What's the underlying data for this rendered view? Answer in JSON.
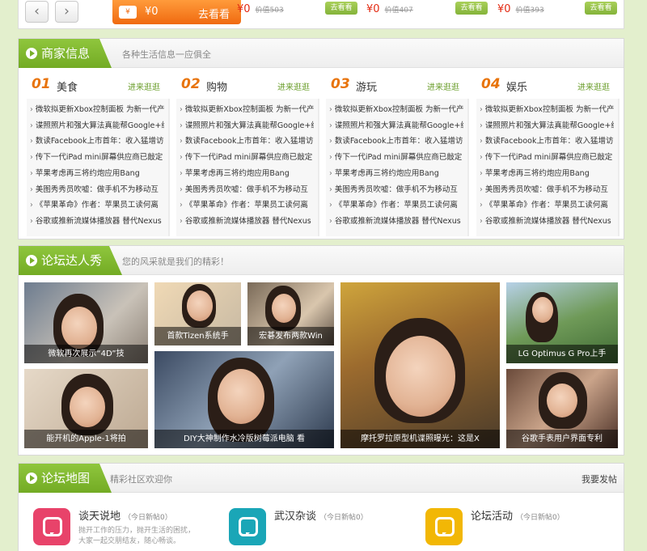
{
  "topstrip": {
    "prev_icon": "‹",
    "next_icon": "›",
    "pill_tag": "¥",
    "pill_price": "¥0",
    "pill_look": "去看看",
    "deals": [
      {
        "price": "¥0",
        "old": "价值503",
        "button": "去看看"
      },
      {
        "price": "¥0",
        "old": "价值407",
        "button": "去看看"
      },
      {
        "price": "¥0",
        "old": "价值393",
        "button": "去看看"
      }
    ]
  },
  "merchant": {
    "title": "商家信息",
    "subtitle": "各种生活信息一应俱全",
    "columns": [
      {
        "num": "01",
        "name": "美食",
        "more": "进来逛逛",
        "items": [
          "微软拟更新Xbox控制面板 为新一代产",
          "谍照照片和强大算法真能帮Google+组",
          "数读Facebook上市首年：收入猛增访",
          "传下一代iPad mini屏幕供应商已敲定",
          "苹果考虑再三将约炮应用Bang",
          "美图秀秀员吹嘘：做手机不为移动互",
          "《苹果革命》作者：苹果员工读何离",
          "谷歌或推新流媒体播放器 替代Nexus"
        ]
      },
      {
        "num": "02",
        "name": "购物",
        "more": "进来逛逛",
        "items": [
          "微软拟更新Xbox控制面板 为新一代产",
          "谍照照片和强大算法真能帮Google+组",
          "数读Facebook上市首年：收入猛增访",
          "传下一代iPad mini屏幕供应商已敲定",
          "苹果考虑再三将约炮应用Bang",
          "美图秀秀员吹嘘：做手机不为移动互",
          "《苹果革命》作者：苹果员工读何离",
          "谷歌或推新流媒体播放器 替代Nexus"
        ]
      },
      {
        "num": "03",
        "name": "游玩",
        "more": "进来逛逛",
        "items": [
          "微软拟更新Xbox控制面板 为新一代产",
          "谍照照片和强大算法真能帮Google+组",
          "数读Facebook上市首年：收入猛增访",
          "传下一代iPad mini屏幕供应商已敲定",
          "苹果考虑再三将约炮应用Bang",
          "美图秀秀员吹嘘：做手机不为移动互",
          "《苹果革命》作者：苹果员工读何离",
          "谷歌或推新流媒体播放器 替代Nexus"
        ]
      },
      {
        "num": "04",
        "name": "娱乐",
        "more": "进来逛逛",
        "items": [
          "微软拟更新Xbox控制面板 为新一代产",
          "谍照照片和强大算法真能帮Google+组",
          "数读Facebook上市首年：收入猛增访",
          "传下一代iPad mini屏幕供应商已敲定",
          "苹果考虑再三将约炮应用Bang",
          "美图秀秀员吹嘘：做手机不为移动互",
          "《苹果革命》作者：苹果员工读何离",
          "谷歌或推新流媒体播放器 替代Nexus"
        ]
      }
    ]
  },
  "gallery": {
    "title": "论坛达人秀",
    "subtitle": "您的风采就是我们的精彩！",
    "photos": [
      {
        "caption": "微软再次展示“4D”技"
      },
      {
        "caption": "首款Tizen系统手"
      },
      {
        "caption": "宏碁发布两款Win"
      },
      {
        "caption": "摩托罗拉原型机谍照曝光：这是X"
      },
      {
        "caption": "LG Optimus G Pro上手"
      },
      {
        "caption": "能开机的Apple-1将拍"
      },
      {
        "caption": "DIY大神制作水冷版树莓派电脑 看"
      },
      {
        "caption": "谷歌手表用户界面专利"
      }
    ]
  },
  "forum_map": {
    "title": "论坛地图",
    "subtitle": "精彩社区欢迎你",
    "post_link": "我要发帖",
    "forums": [
      {
        "name": "谈天说地",
        "today": "（今日新帖0）",
        "desc": "抛开工作的压力，抛开生活的困扰，大家一起交朋结友，随心畅谈。",
        "color": "#e8436a"
      },
      {
        "name": "武汉杂谈",
        "today": "（今日新帖0）",
        "desc": "",
        "color": "#1aa6b7"
      },
      {
        "name": "论坛活动",
        "today": "（今日新帖0）",
        "desc": "",
        "color": "#f2b705"
      }
    ]
  }
}
